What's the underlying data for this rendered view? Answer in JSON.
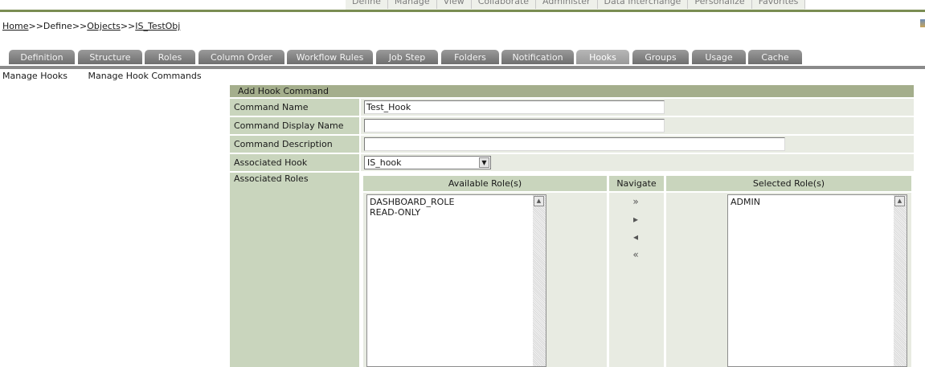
{
  "top_menu": [
    "Define",
    "Manage",
    "View",
    "Collaborate",
    "Administer",
    "Data Interchange",
    "Personalize",
    "Favorites"
  ],
  "breadcrumb": {
    "home": "Home",
    "sep": ">>",
    "define": "Define",
    "objects": "Objects",
    "current": "IS_TestObj"
  },
  "tabs": [
    "Definition",
    "Structure",
    "Roles",
    "Column Order",
    "Workflow Rules",
    "Job Step",
    "Folders",
    "Notification",
    "Hooks",
    "Groups",
    "Usage",
    "Cache"
  ],
  "active_tab": "Hooks",
  "subnav": [
    "Manage Hooks",
    "Manage Hook Commands"
  ],
  "form": {
    "title": "Add Hook Command",
    "command_name_label": "Command Name",
    "command_name_value": "Test_Hook",
    "display_name_label": "Command Display Name",
    "display_name_value": "",
    "description_label": "Command Description",
    "description_value": "",
    "hook_label": "Associated Hook",
    "hook_value": "IS_hook",
    "roles_label": "Associated Roles"
  },
  "roles": {
    "available_header": "Available Role(s)",
    "navigate_header": "Navigate",
    "selected_header": "Selected Role(s)",
    "available": [
      "DASHBOARD_ROLE",
      "READ-ONLY"
    ],
    "selected": [
      "ADMIN"
    ]
  },
  "colors": {
    "accent_green": "#7a8d53",
    "label_bg": "#c9d5bd",
    "title_bg": "#a4ae8c",
    "tab_bg": "#808080"
  }
}
